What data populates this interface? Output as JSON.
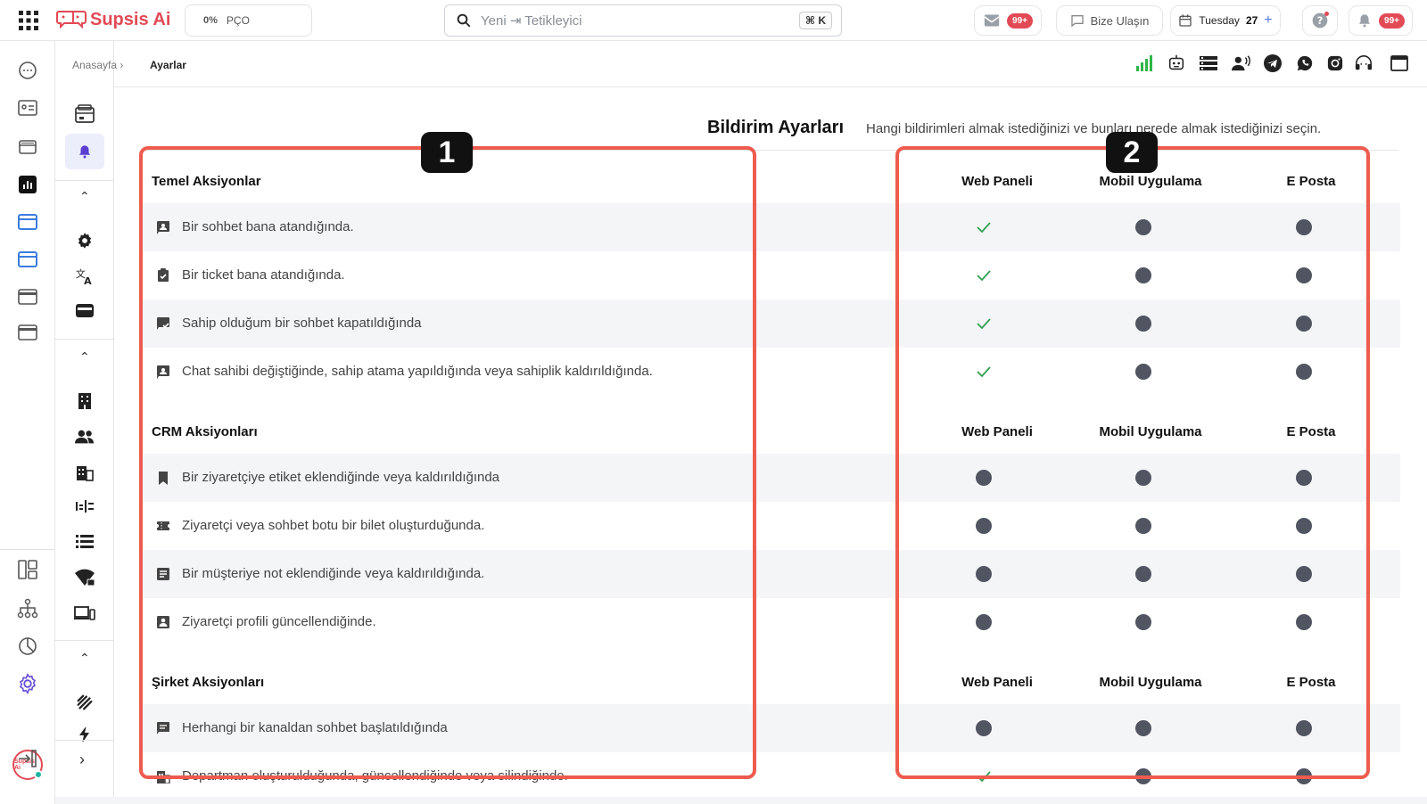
{
  "app": {
    "name": "Supsis Ai"
  },
  "topbar": {
    "progress": {
      "percent": "0%",
      "label": "PÇO"
    },
    "search": {
      "placeholder": "Yeni ⇥ Tetikleyici",
      "shortcut": "⌘ K"
    },
    "inbox_badge": "99+",
    "contact_label": "Bize Ulaşın",
    "calendar": {
      "day": "Tuesday",
      "date": "27"
    },
    "notifications_badge": "99+"
  },
  "breadcrumb": {
    "home": "Anasayfa ›",
    "current": "Ayarlar"
  },
  "header": {
    "title": "Bildirim Ayarları",
    "subtitle": "Hangi bildirimleri almak istediğinizi ve bunları nerede almak istediğinizi seçin."
  },
  "annotations": {
    "left_box": "1",
    "right_box": "2"
  },
  "columns": [
    "Web Paneli",
    "Mobil Uygulama",
    "E Posta"
  ],
  "sections": [
    {
      "title": "Temel Aksiyonlar",
      "rows": [
        {
          "label": "Bir sohbet bana atandığında.",
          "icon": "chat-assign-icon",
          "web": true,
          "mobile": false,
          "email": false
        },
        {
          "label": "Bir ticket bana atandığında.",
          "icon": "ticket-check-icon",
          "web": true,
          "mobile": false,
          "email": false
        },
        {
          "label": "Sahip olduğum bir sohbet kapatıldığında",
          "icon": "chat-closed-icon",
          "web": true,
          "mobile": false,
          "email": false
        },
        {
          "label": "Chat sahibi değiştiğinde, sahip atama yapıldığında veya sahiplik kaldırıldığında.",
          "icon": "owner-change-icon",
          "web": true,
          "mobile": false,
          "email": false
        }
      ]
    },
    {
      "title": "CRM Aksiyonları",
      "rows": [
        {
          "label": "Bir ziyaretçiye etiket eklendiğinde veya kaldırıldığında",
          "icon": "bookmark-icon",
          "web": false,
          "mobile": false,
          "email": false
        },
        {
          "label": "Ziyaretçi veya sohbet botu bir bilet oluşturduğunda.",
          "icon": "ticket-icon",
          "web": false,
          "mobile": false,
          "email": false
        },
        {
          "label": "Bir müşteriye not eklendiğinde veya kaldırıldığında.",
          "icon": "note-icon",
          "web": false,
          "mobile": false,
          "email": false
        },
        {
          "label": "Ziyaretçi profili güncellendiğinde.",
          "icon": "profile-icon",
          "web": false,
          "mobile": false,
          "email": false
        }
      ]
    },
    {
      "title": "Şirket Aksiyonları",
      "rows": [
        {
          "label": "Herhangi bir kanaldan sohbet başlatıldığında",
          "icon": "chat-icon",
          "web": false,
          "mobile": false,
          "email": false
        },
        {
          "label": "Departman oluşturulduğunda, güncellendiğinde veya silindiğinde.",
          "icon": "building-icon",
          "web": true,
          "mobile": false,
          "email": false
        }
      ]
    }
  ],
  "colors": {
    "accent": "#e24a55",
    "annotation": "#ee5b4f",
    "check": "#2e9e4f",
    "dot": "#505561"
  }
}
